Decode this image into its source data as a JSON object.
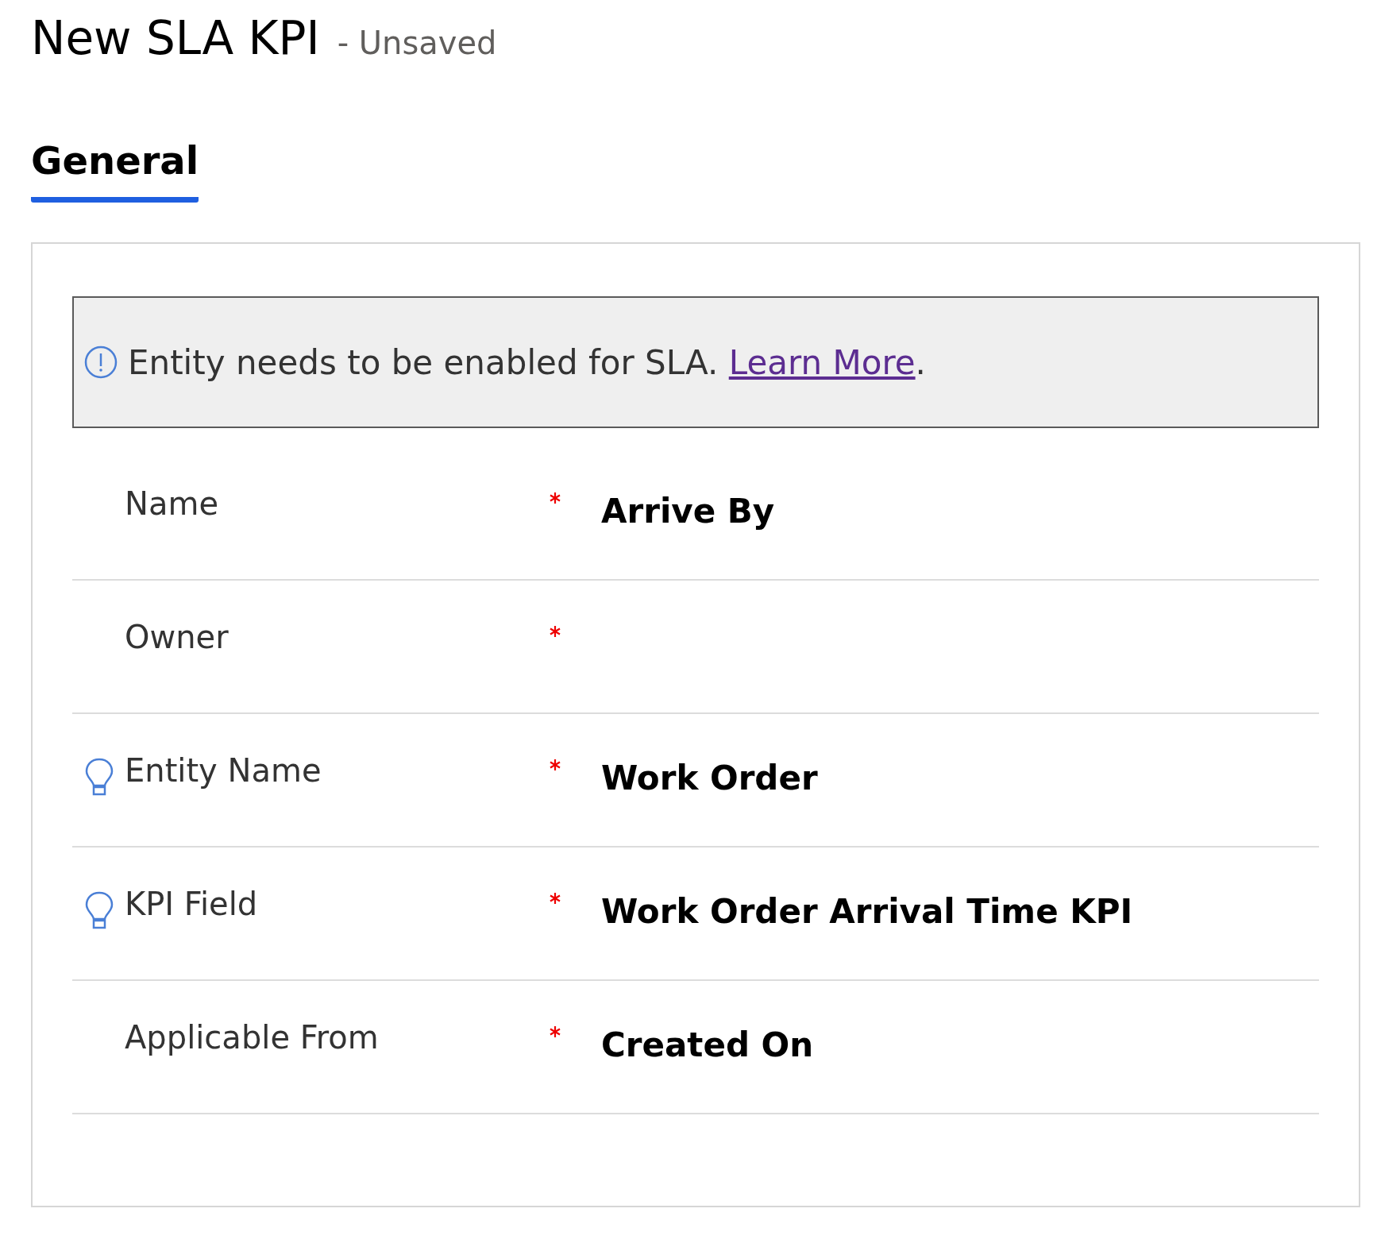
{
  "header": {
    "title": "New SLA KPI",
    "status": "- Unsaved"
  },
  "tabs": [
    {
      "label": "General",
      "selected": true
    }
  ],
  "notice": {
    "text": "Entity needs to be enabled for SLA.",
    "link": "Learn More",
    "end": "."
  },
  "fields": [
    {
      "label": "Name",
      "required": true,
      "hint": false,
      "value": "Arrive By"
    },
    {
      "label": "Owner",
      "required": true,
      "hint": false
    },
    {
      "label": "Entity Name",
      "required": true,
      "hint": true,
      "value": "Work Order"
    },
    {
      "label": "KPI Field",
      "required": true,
      "hint": true,
      "value": "Work Order Arrival Time KPI"
    },
    {
      "label": "Applicable From",
      "required": true,
      "hint": false,
      "value": "Created On"
    }
  ]
}
